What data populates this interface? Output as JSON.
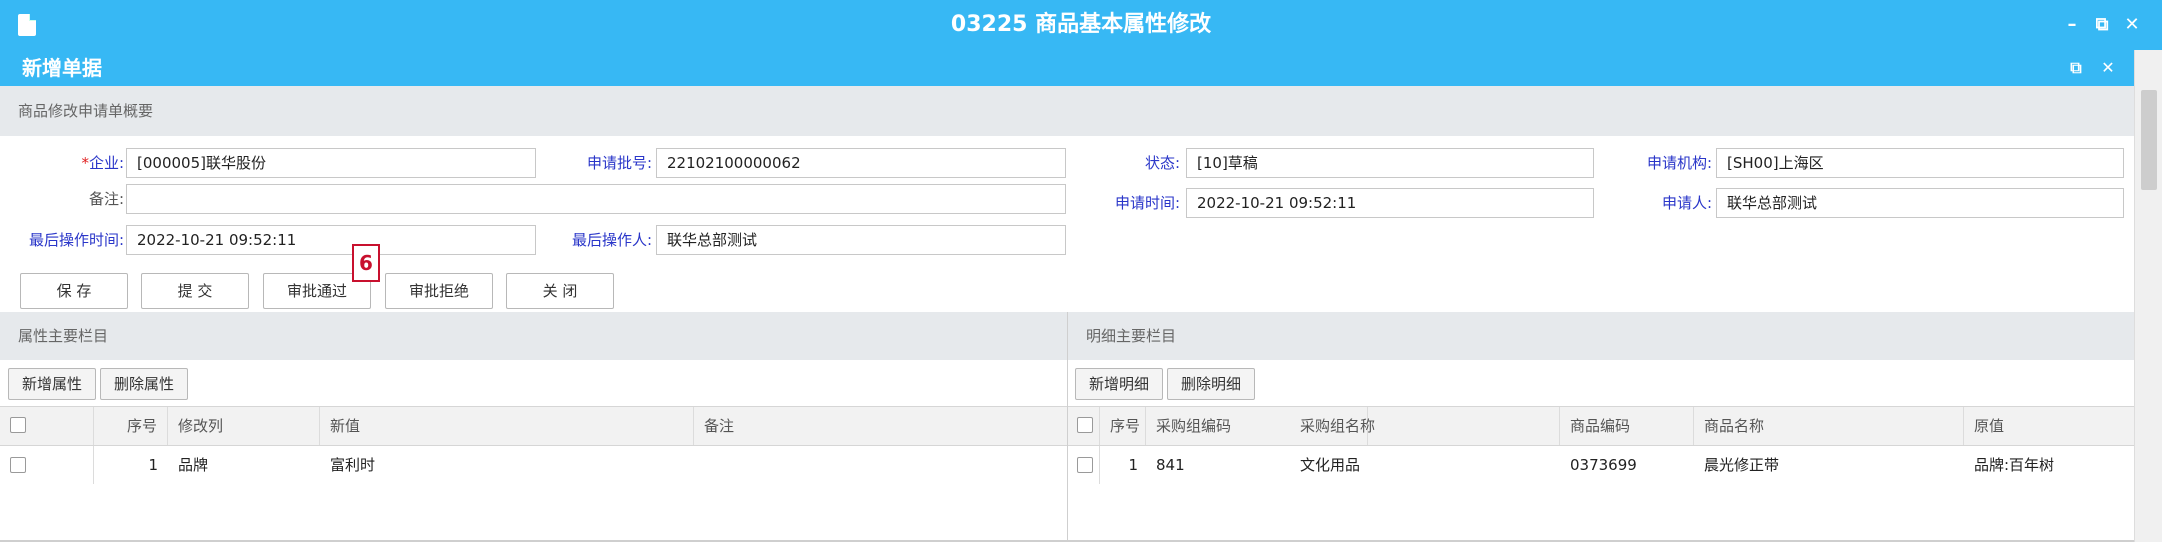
{
  "window": {
    "title": "03225 商品基本属性修改",
    "minimize": "–",
    "restore": "⧉",
    "close": "✕"
  },
  "dialog": {
    "title": "新增单据",
    "restore": "⧉",
    "close": "✕"
  },
  "summary_section": {
    "title": "商品修改申请单概要"
  },
  "form": {
    "company": {
      "required_mark": "*",
      "label": "企业:",
      "value": "[000005]联华股份"
    },
    "batch_no": {
      "label": "申请批号:",
      "value": "22102100000062"
    },
    "status": {
      "label": "状态:",
      "value": "[10]草稿"
    },
    "apply_org": {
      "label": "申请机构:",
      "value": "[SH00]上海区"
    },
    "remark": {
      "label": "备注:",
      "value": ""
    },
    "apply_time": {
      "label": "申请时间:",
      "value": "2022-10-21 09:52:11"
    },
    "applicant": {
      "label": "申请人:",
      "value": "联华总部测试"
    },
    "last_op_time": {
      "label": "最后操作时间:",
      "value": "2022-10-21 09:52:11"
    },
    "last_operator": {
      "label": "最后操作人:",
      "value": "联华总部测试"
    }
  },
  "actions": {
    "save": "保 存",
    "submit": "提 交",
    "approve": "审批通过",
    "reject": "审批拒绝",
    "close": "关 闭"
  },
  "step_badge": "6",
  "attr_panel": {
    "title": "属性主要栏目",
    "add_button": "新增属性",
    "delete_button": "删除属性",
    "columns": [
      "序号",
      "修改列",
      "新值",
      "备注"
    ],
    "rows": [
      {
        "seq": "1",
        "column": "品牌",
        "new_value": "富利时",
        "remark": ""
      }
    ]
  },
  "detail_panel": {
    "title": "明细主要栏目",
    "add_button": "新增明细",
    "delete_button": "删除明细",
    "columns": [
      "序号",
      "采购组编码",
      "采购组名称",
      "商品编码",
      "商品名称",
      "原值"
    ],
    "rows": [
      {
        "seq": "1",
        "group_code": "841",
        "group_name": "文化用品",
        "goods_code": "0373699",
        "goods_name": "晨光修正带",
        "original": "品牌:百年树"
      }
    ]
  },
  "colors": {
    "header_blue": "#37b8f4",
    "label_blue": "#2a36c9",
    "accent_red": "#c8102e",
    "section_gray": "#e6e9ec"
  }
}
